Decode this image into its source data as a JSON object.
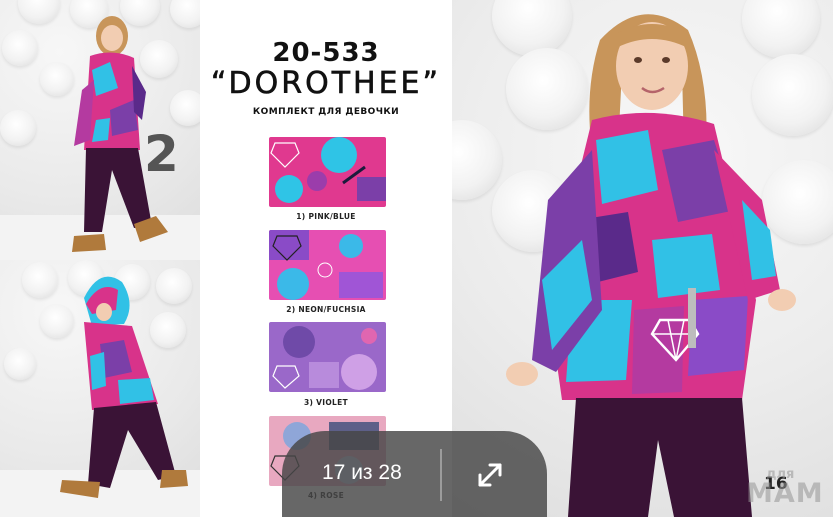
{
  "product": {
    "code": "20-533",
    "name": "“DOROTHEE”",
    "subtitle": "КОМПЛЕКТ ДЛЯ ДЕВОЧКИ"
  },
  "swatches": [
    {
      "label": "1) PINK/BLUE",
      "colors": [
        "#e0398f",
        "#2fc4e6",
        "#7b3fa8"
      ]
    },
    {
      "label": "2) NEON/FUCHSIA",
      "colors": [
        "#e64fb2",
        "#3bb9e8",
        "#8a4bc7"
      ]
    },
    {
      "label": "3) VIOLET",
      "colors": [
        "#9a68c9",
        "#6f4aa8",
        "#cfa0e6"
      ]
    },
    {
      "label": "4) ROSE",
      "colors": [
        "#e8a8c0",
        "#8fa6d8",
        "#5d5f88"
      ]
    }
  ],
  "photo_number_left": "2",
  "photo_number_right": "16",
  "gallery": {
    "counter": "17 из 28",
    "expand_icon": "expand-arrows-icon"
  },
  "watermark": {
    "line1": "для",
    "line2": "МАМ"
  },
  "colors": {
    "suit_purple": "#3a1336",
    "jacket_pink": "#d8338a",
    "jacket_blue": "#31c1e6",
    "overlay": "#474747"
  }
}
